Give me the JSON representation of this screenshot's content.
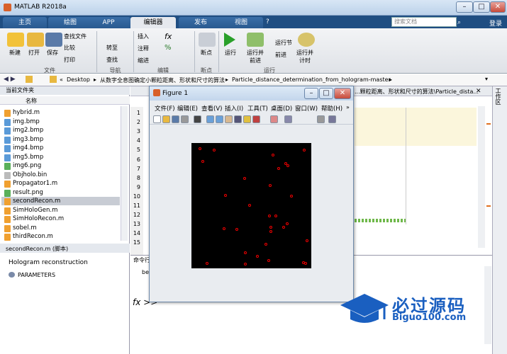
{
  "window": {
    "title": "MATLAB R2018a",
    "min": "–",
    "max": "□",
    "close": "✕"
  },
  "tabs": [
    {
      "label": "主页",
      "active": false
    },
    {
      "label": "绘图",
      "active": false
    },
    {
      "label": "APP",
      "active": false
    },
    {
      "label": "编辑器",
      "active": true
    },
    {
      "label": "发布",
      "active": false
    },
    {
      "label": "视图",
      "active": false
    }
  ],
  "search": {
    "placeholder": "搜索文档"
  },
  "login": "登录",
  "ribbon": {
    "file": {
      "new": "新建",
      "open": "打开",
      "save": "保存",
      "find_file": "查找文件",
      "compare": "比较",
      "print": "打印",
      "group": "文件"
    },
    "navigate": {
      "goto": "转至",
      "find": "查找",
      "group": "导航"
    },
    "edit": {
      "insert": "插入",
      "comment": "注释",
      "indent": "缩进",
      "group": "编辑"
    },
    "breakpoints": {
      "label": "断点",
      "group": "断点"
    },
    "run": {
      "run": "运行",
      "run_advance": "运行并\n前进",
      "run_section": "运行节",
      "advance": "前进",
      "run_time": "运行并\n计时",
      "group": "运行"
    }
  },
  "address": {
    "prefix": "«",
    "path": [
      "Desktop",
      "从数字全息图确定小颗粒距离、形状和尺寸的算法",
      "Particle_distance_determination_from_hologram-master"
    ]
  },
  "current_folder": {
    "title": "当前文件夹",
    "column": "名称",
    "files": [
      {
        "name": "hybrid.m",
        "type": "m"
      },
      {
        "name": "img.bmp",
        "type": "bmp"
      },
      {
        "name": "img2.bmp",
        "type": "bmp"
      },
      {
        "name": "img3.bmp",
        "type": "bmp"
      },
      {
        "name": "img4.bmp",
        "type": "bmp"
      },
      {
        "name": "img5.bmp",
        "type": "bmp"
      },
      {
        "name": "img6.png",
        "type": "png"
      },
      {
        "name": "Objholo.bin",
        "type": "bin"
      },
      {
        "name": "Propagator1.m",
        "type": "m"
      },
      {
        "name": "result.png",
        "type": "png"
      },
      {
        "name": "secondRecon.m",
        "type": "m",
        "selected": true
      },
      {
        "name": "SimHoloGen.m",
        "type": "m"
      },
      {
        "name": "SimHoloRecon.m",
        "type": "m"
      },
      {
        "name": "sobel.m",
        "type": "m"
      },
      {
        "name": "thirdRecon.m",
        "type": "m"
      }
    ],
    "details_title": "secondRecon.m (脚本)",
    "description": "Hologram reconstruction",
    "param": "PARAMETERS"
  },
  "editor": {
    "tab_path": "...颗粒距离、形状和尺寸的算法\\Particle_dista...",
    "line_numbers": [
      "1",
      "2",
      "3",
      "4",
      "5",
      "6",
      "7",
      "8",
      "9",
      "10",
      "11",
      "12",
      "13",
      "14",
      "15"
    ]
  },
  "command_window": {
    "title": "命令行",
    "line": "be",
    "prompt": "fx >>"
  },
  "workspace_label": "工作区",
  "figure": {
    "title": "Figure 1",
    "menu": [
      "文件(F)",
      "编辑(E)",
      "查看(V)",
      "插入(I)",
      "工具(T)",
      "桌面(D)",
      "窗口(W)",
      "帮助(H)"
    ],
    "min": "–",
    "max": "□",
    "close": "✕"
  },
  "watermark": {
    "text": "必过源码",
    "url": "Biguo100.com"
  },
  "colors": {
    "accent": "#1f4e82",
    "marker": "#e00000",
    "watermark": "#1a5fc0"
  }
}
